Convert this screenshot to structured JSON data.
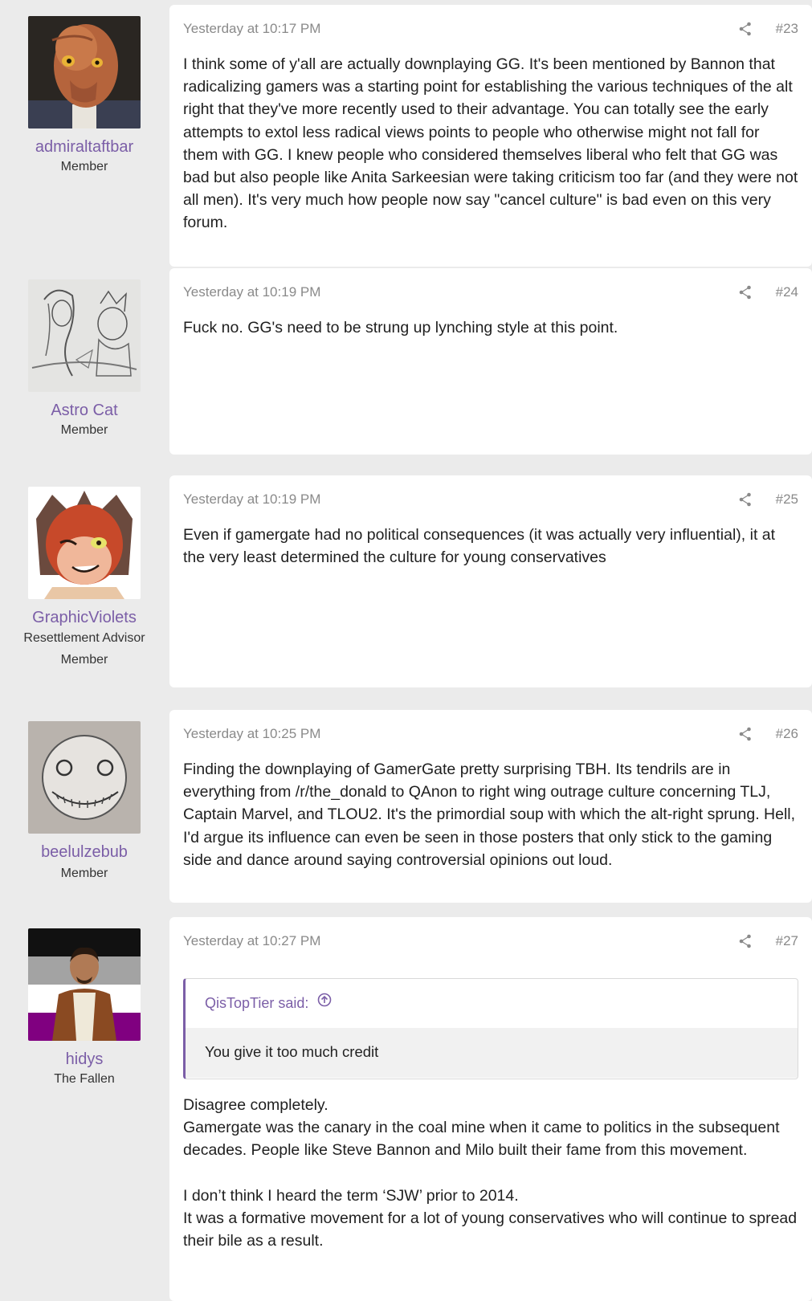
{
  "posts": [
    {
      "username": "admiraltaftbar",
      "title": "",
      "role": "Member",
      "avatar": "alien-admiral-avatar",
      "time": "Yesterday at 10:17 PM",
      "number": "#23",
      "paragraphs": [
        "I think some of y'all are actually downplaying GG. It's been mentioned by Bannon that radicalizing gamers was a starting point for establishing the various techniques of the alt right that they've more recently used to their advantage. You can totally see the early attempts to extol less radical views points to people who otherwise might not fall for them with GG. I knew people who considered themselves liberal who felt that GG was bad but also people like Anita Sarkeesian were taking criticism too far (and they were not all men). It's very much how people now say \"cancel culture\" is bad even on this very forum."
      ]
    },
    {
      "username": "Astro Cat",
      "title": "",
      "role": "Member",
      "avatar": "pencil-sketch-avatar",
      "time": "Yesterday at 10:19 PM",
      "number": "#24",
      "paragraphs": [
        "Fuck no. GG's need to be strung up lynching style at this point."
      ]
    },
    {
      "username": "GraphicViolets",
      "title": "Resettlement Advisor",
      "role": "Member",
      "avatar": "cartoon-cat-avatar",
      "time": "Yesterday at 10:19 PM",
      "number": "#25",
      "paragraphs": [
        "Even if gamergate had no political consequences (it was actually very influential), it at the very least determined the culture for young conservatives"
      ]
    },
    {
      "username": "beelulzebub",
      "title": "",
      "role": "Member",
      "avatar": "moon-face-avatar",
      "time": "Yesterday at 10:25 PM",
      "number": "#26",
      "paragraphs": [
        "Finding the downplaying of GamerGate pretty surprising TBH. Its tendrils are in everything from /r/the_donald to QAnon to right wing outrage culture concerning TLJ, Captain Marvel, and TLOU2. It's the primordial soup with which the alt-right sprung. Hell, I'd argue its influence can even be seen in those posters that only stick to the gaming side and dance around saying controversial opinions out loud."
      ]
    },
    {
      "username": "hidys",
      "title": "The Fallen",
      "role": "",
      "avatar": "costumed-man-flag-avatar",
      "time": "Yesterday at 10:27 PM",
      "number": "#27",
      "quote": {
        "author": "QisTopTier said:",
        "text": "You give it too much credit"
      },
      "paragraphs": [
        "Disagree completely.",
        "Gamergate was the canary in the coal mine when it came to politics in the subsequent decades. People like Steve Bannon and Milo built their fame from this movement.",
        "",
        "I don’t think I heard the term ‘SJW’ prior to 2014.",
        "It was a formative movement for a lot of young conservatives who will continue to spread their bile as a result."
      ]
    }
  ],
  "colors": {
    "accent": "#7b5ea7",
    "background": "#ebebeb",
    "card": "#ffffff",
    "meta": "#8a8a8a"
  }
}
